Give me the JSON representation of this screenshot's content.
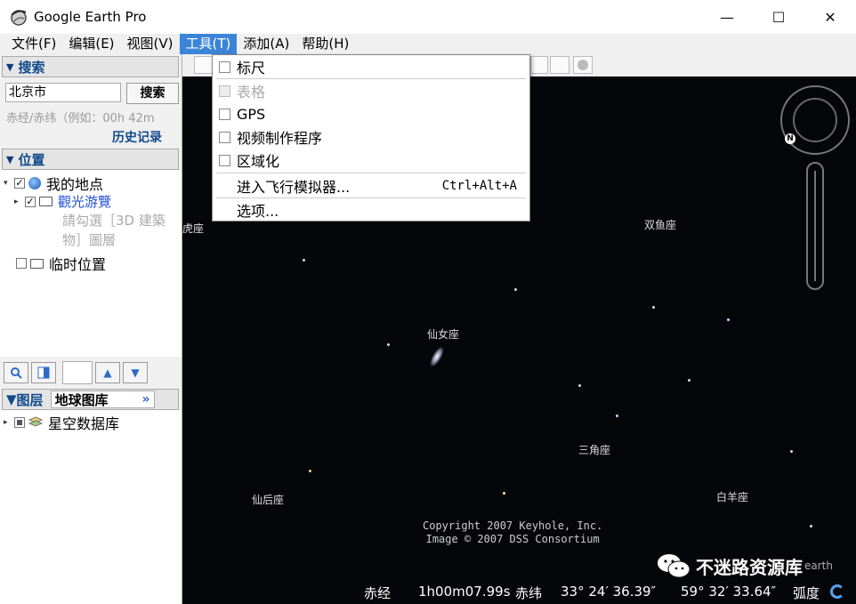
{
  "window": {
    "title": "Google Earth Pro",
    "minimize": "—",
    "maximize": "☐",
    "close": "✕"
  },
  "menubar": {
    "items": [
      "文件(F)",
      "编辑(E)",
      "视图(V)",
      "工具(T)",
      "添加(A)",
      "帮助(H)"
    ],
    "active": "工具(T)"
  },
  "tools_menu": {
    "items": [
      {
        "label": "标尺",
        "check": true,
        "disabled": false
      },
      {
        "label": "表格",
        "check": true,
        "disabled": true
      },
      {
        "label": "GPS",
        "check": true,
        "disabled": false
      },
      {
        "label": "视频制作程序",
        "check": true,
        "disabled": false
      },
      {
        "label": "区域化",
        "check": true,
        "disabled": false
      },
      {
        "label": "进入飞行模拟器...",
        "shortcut": "Ctrl+Alt+A"
      },
      {
        "label": "选项..."
      }
    ]
  },
  "search": {
    "header": "搜索",
    "value": "北京市",
    "button": "搜索",
    "hint": "赤经/赤纬（例如：00h 42m",
    "history": "历史记录"
  },
  "places": {
    "header": "位置",
    "my_places": "我的地点",
    "sightseeing": "觀光游覽",
    "note_line1": "請勾選［3D 建築",
    "note_line2": "物］圖層",
    "temp": "临时位置"
  },
  "layers": {
    "tab_layers": "图层",
    "tab_gallery": "地球图库",
    "more": "»",
    "item": "星空数据库"
  },
  "sky": {
    "labels": [
      "虎座",
      "双鱼座",
      "仙女座",
      "三角座",
      "仙后座",
      "白羊座"
    ],
    "copyright_line1": "Copyright 2007 Keyhole, Inc.",
    "copyright_line2": "Image © 2007 DSS Consortium",
    "nav_letter": "N",
    "earth_fragment": "earth"
  },
  "status": {
    "ra_label": "赤经",
    "ra_value": "1h00m07.99s",
    "dec_label": "赤纬",
    "dec_value": "33° 24′ 36.39″",
    "arc_value": "59° 32′ 33.64″",
    "arc_label": "弧度"
  },
  "watermark": {
    "text": "不迷路资源库"
  }
}
